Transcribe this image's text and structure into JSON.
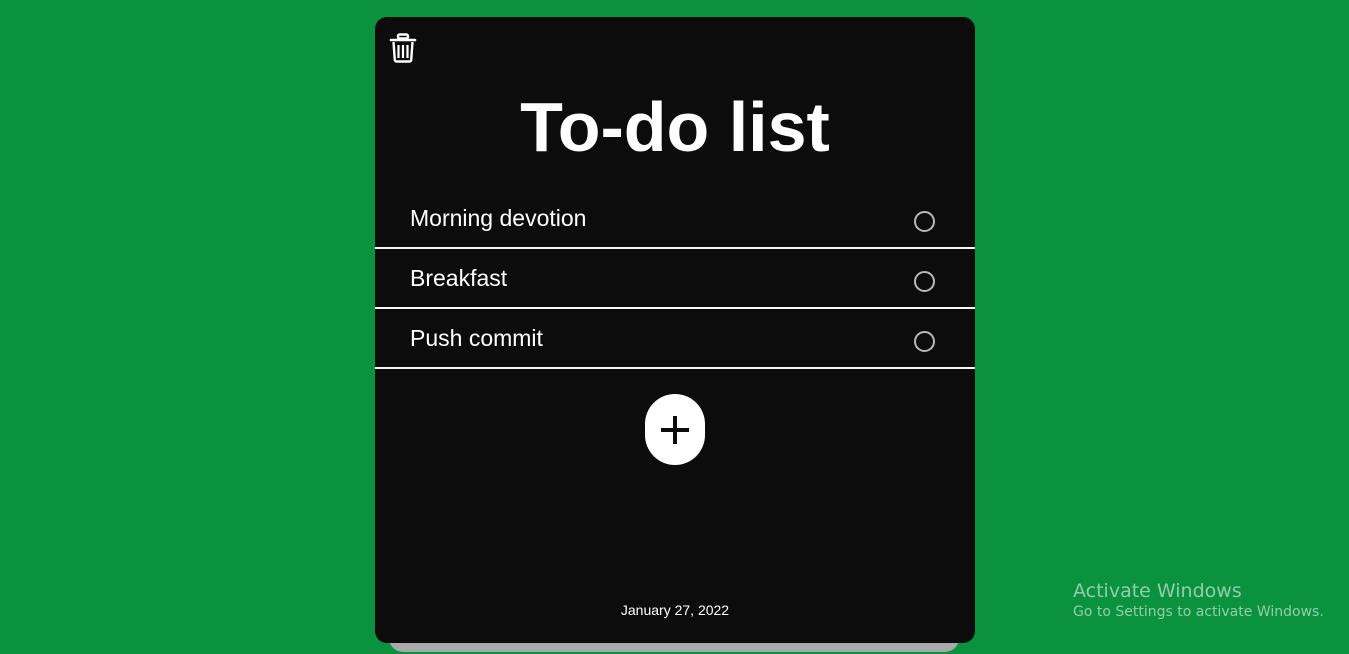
{
  "app": {
    "title": "To-do list",
    "date": "January 27, 2022"
  },
  "tasks": [
    {
      "label": "Morning devotion",
      "done": false
    },
    {
      "label": "Breakfast",
      "done": false
    },
    {
      "label": "Push commit",
      "done": false
    }
  ],
  "toolbar": {
    "delete_icon": "trash-icon",
    "add_icon": "plus-icon"
  },
  "watermark": {
    "title": "Activate Windows",
    "subtitle": "Go to Settings to activate Windows."
  },
  "colors": {
    "background": "#0b923e",
    "card": "#0c0c0c",
    "card_shadow": "#a7a9ad",
    "text": "#ffffff",
    "divider": "#f5f5f5"
  }
}
